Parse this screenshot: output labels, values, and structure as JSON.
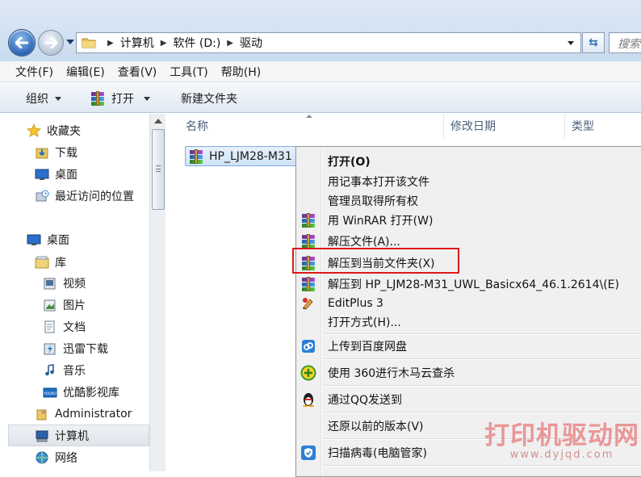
{
  "window": {
    "address_path": [
      "计算机",
      "软件 (D:)",
      "驱动"
    ],
    "search_placeholder": "搜索"
  },
  "menubar": [
    "文件(F)",
    "编辑(E)",
    "查看(V)",
    "工具(T)",
    "帮助(H)"
  ],
  "commandbar": {
    "organize": "组织",
    "open": "打开",
    "new_folder": "新建文件夹"
  },
  "nav": {
    "favorites": "收藏夹",
    "downloads": "下载",
    "desktop_fav": "桌面",
    "recent": "最近访问的位置",
    "desktop": "桌面",
    "libraries": "库",
    "videos": "视频",
    "pictures": "图片",
    "documents": "文档",
    "thunder": "迅雷下载",
    "music": "音乐",
    "youku": "优酷影视库",
    "youku_badge": "YOUKU",
    "admin": "Administrator",
    "computer": "计算机",
    "network": "网络"
  },
  "columns": {
    "name": "名称",
    "modified": "修改日期",
    "type": "类型"
  },
  "file": {
    "name": "HP_LJM28-M31"
  },
  "context_menu": {
    "open": "打开(O)",
    "notepad": "用记事本打开该文件",
    "admin_owner": "管理员取得所有权",
    "winrar_open": "用 WinRAR 打开(W)",
    "extract": "解压文件(A)...",
    "extract_here": "解压到当前文件夹(X)",
    "extract_to": "解压到 HP_LJM28-M31_UWL_Basicx64_46.1.2614\\(E)",
    "editplus": "EditPlus 3",
    "open_with": "打开方式(H)...",
    "baidu": "上传到百度网盘",
    "scan360": "使用 360进行木马云查杀",
    "qq": "通过QQ发送到",
    "restore": "还原以前的版本(V)",
    "virus_scan": "扫描病毒(电脑管家)"
  },
  "watermark": {
    "title": "打印机驱动网",
    "url": "www.dyjqd.com"
  },
  "colors": {
    "highlight": "#e01818",
    "selection": "#cfe3f7"
  }
}
